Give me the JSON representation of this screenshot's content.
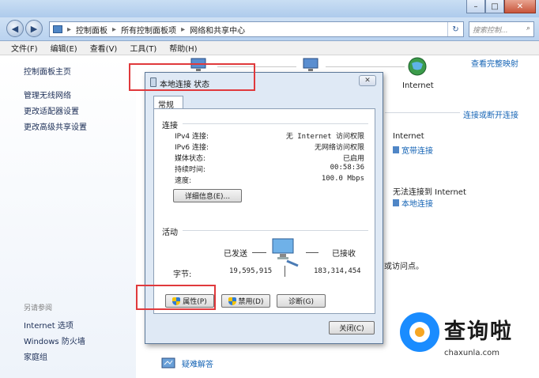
{
  "addressbar": {
    "crumbs": [
      "控制面板",
      "所有控制面板项",
      "网络和共享中心"
    ],
    "search_placeholder": "搜索控制...",
    "window_controls": [
      "–",
      "□",
      "✕"
    ]
  },
  "menu": [
    "文件(F)",
    "编辑(E)",
    "查看(V)",
    "工具(T)",
    "帮助(H)"
  ],
  "leftnav": {
    "home": "控制面板主页",
    "links": [
      "管理无线网络",
      "更改适配器设置",
      "更改高级共享设置"
    ],
    "see_also_title": "另请参阅",
    "see_also": [
      "Internet 选项",
      "Windows 防火墙",
      "家庭组"
    ]
  },
  "main": {
    "view_full_map": "查看完整映射",
    "internet_label": "Internet",
    "connect_disconnect": "连接或断开连接",
    "access_type_1": "Internet",
    "network_1": "宽带连接",
    "access_type_2": "无法连接到 Internet",
    "network_2": "本地连接",
    "partial_text": "或访问点。",
    "troubleshoot": "疑难解答"
  },
  "dialog": {
    "title": "本地连接 状态",
    "tab": "常规",
    "connection_group": "连接",
    "rows": [
      {
        "label": "IPv4 连接:",
        "value": "无 Internet 访问权限"
      },
      {
        "label": "IPv6 连接:",
        "value": "无网络访问权限"
      },
      {
        "label": "媒体状态:",
        "value": "已启用"
      },
      {
        "label": "持续时间:",
        "value": "00:58:36"
      },
      {
        "label": "速度:",
        "value": "100.0 Mbps"
      }
    ],
    "details_button": "详细信息(E)...",
    "activity_group": "活动",
    "sent_label": "已发送",
    "received_label": "已接收",
    "bytes_label": "字节:",
    "bytes_sent": "19,595,915",
    "bytes_received": "183,314,454",
    "properties_button": "属性(P)",
    "disable_button": "禁用(D)",
    "diagnose_button": "诊断(G)",
    "close_button": "关闭(C)"
  },
  "watermark": {
    "brand": "查询啦",
    "url": "chaxunla.com"
  },
  "colors": {
    "highlight_box": "#e0393c",
    "link": "#1564b5",
    "watermark_blue": "#1a8cff"
  }
}
